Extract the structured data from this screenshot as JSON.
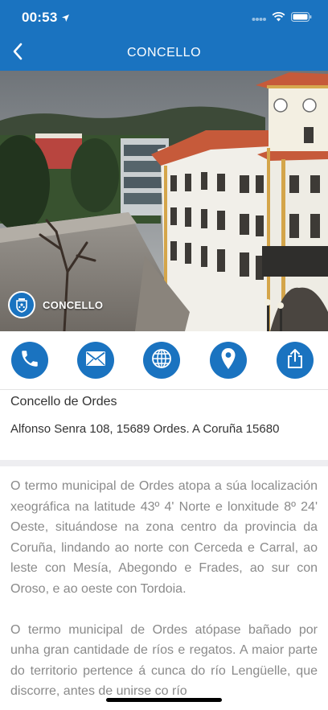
{
  "status_bar": {
    "time": "00:53",
    "location_icon": "location-arrow-icon",
    "icons": [
      "signal-dots-icon",
      "wifi-icon",
      "battery-icon"
    ]
  },
  "nav": {
    "back_icon": "chevron-left-icon",
    "title": "CONCELLO"
  },
  "hero": {
    "image": "town-hall-photo",
    "badge_icon": "coat-of-arms-icon",
    "badge_label": "CONCELLO"
  },
  "actions": [
    {
      "name": "call",
      "icon": "phone-icon"
    },
    {
      "name": "email",
      "icon": "mail-icon"
    },
    {
      "name": "web",
      "icon": "globe-icon"
    },
    {
      "name": "map",
      "icon": "map-pin-icon"
    },
    {
      "name": "share",
      "icon": "share-icon"
    }
  ],
  "info": {
    "name": "Concello de Ordes",
    "address": "Alfonso Senra 108, 15689 Ordes. A Coruña 15680"
  },
  "description": {
    "paragraph_1": "O termo municipal de Ordes atopa a súa localización xeográfica na latitude 43º 4' Norte e lonxitude 8º 24' Oeste, situándose na zona centro da provincia da Coruña, lindando ao norte con Cerceda e Carral, ao leste con Mesía, Abegondo e Frades, ao sur con Oroso, e ao oeste con Tordoia.",
    "paragraph_2": "O termo municipal de Ordes atópase bañado por unha gran cantidade de ríos e regatos. A maior parte do territorio pertence á cunca do río Lengüelle, que discorre, antes de unirse co río"
  },
  "colors": {
    "brand_blue": "#1a73c0",
    "text_dark": "#333333",
    "text_muted": "#8a8a8a"
  }
}
